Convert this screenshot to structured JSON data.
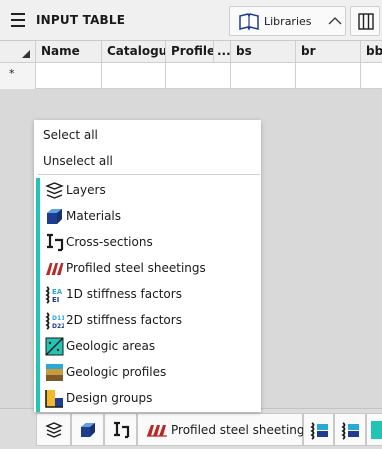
{
  "header": {
    "title": "INPUT TABLE",
    "libraries_label": "Libraries"
  },
  "table": {
    "columns": [
      "Name",
      "Catalogue",
      "Profile",
      "...",
      "bs",
      "br",
      "bb"
    ],
    "new_row_marker": "*"
  },
  "popup": {
    "select_all": "Select all",
    "unselect_all": "Unselect all",
    "items": [
      {
        "label": "Layers",
        "icon": "layers-icon"
      },
      {
        "label": "Materials",
        "icon": "materials-icon"
      },
      {
        "label": "Cross-sections",
        "icon": "cross-section-icon"
      },
      {
        "label": "Profiled steel sheetings",
        "icon": "sheeting-icon"
      },
      {
        "label": "1D stiffness factors",
        "icon": "stiffness-1d-icon"
      },
      {
        "label": "2D stiffness factors",
        "icon": "stiffness-2d-icon"
      },
      {
        "label": "Geologic areas",
        "icon": "geologic-area-icon"
      },
      {
        "label": "Geologic profiles",
        "icon": "geologic-profile-icon"
      },
      {
        "label": "Design groups",
        "icon": "design-groups-icon"
      }
    ]
  },
  "bottom_toolbar": {
    "active_tab_label": "Profiled steel sheetings"
  },
  "colors": {
    "accent": "#22c4b4",
    "icon_blue": "#1f3d8f",
    "sheeting_red": "#b52b27"
  }
}
